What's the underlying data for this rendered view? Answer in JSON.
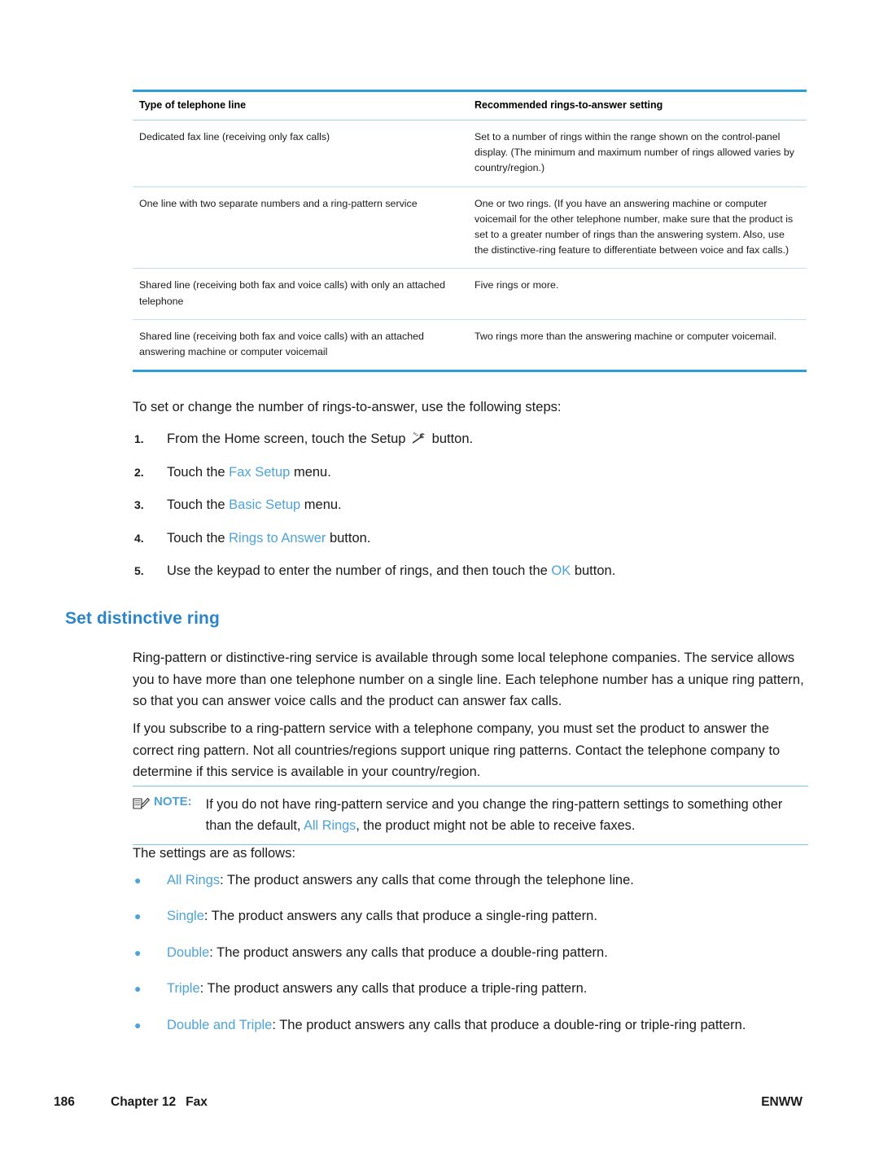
{
  "table": {
    "headers": [
      "Type of telephone line",
      "Recommended rings-to-answer setting"
    ],
    "rows": [
      {
        "type": "Dedicated fax line (receiving only fax calls)",
        "setting": "Set to a number of rings within the range shown on the control-panel display. (The minimum and maximum number of rings allowed varies by country/region.)"
      },
      {
        "type": "One line with two separate numbers and a ring-pattern service",
        "setting": "One or two rings. (If you have an answering machine or computer voicemail for the other telephone number, make sure that the product is set to a greater number of rings than the answering system. Also, use the distinctive-ring feature to differentiate between voice and fax calls.)"
      },
      {
        "type": "Shared line (receiving both fax and voice calls) with only an attached telephone",
        "setting": "Five rings or more."
      },
      {
        "type": "Shared line (receiving both fax and voice calls) with an attached answering machine or computer voicemail",
        "setting": "Two rings more than the answering machine or computer voicemail."
      }
    ]
  },
  "intro": "To set or change the number of rings-to-answer, use the following steps:",
  "steps": [
    {
      "num": "1.",
      "pre": "From the Home screen, touch the Setup ",
      "ui": "",
      "post": " button.",
      "icon": "setup-wrench-icon"
    },
    {
      "num": "2.",
      "pre": "Touch the ",
      "ui": "Fax Setup",
      "post": " menu."
    },
    {
      "num": "3.",
      "pre": "Touch the ",
      "ui": "Basic Setup",
      "post": " menu."
    },
    {
      "num": "4.",
      "pre": "Touch the ",
      "ui": "Rings to Answer",
      "post": " button."
    },
    {
      "num": "5.",
      "pre": "Use the keypad to enter the number of rings, and then touch the ",
      "ui": "OK",
      "post": " button."
    }
  ],
  "heading": "Set distinctive ring",
  "paragraphs": {
    "p1": "Ring-pattern or distinctive-ring service is available through some local telephone companies. The service allows you to have more than one telephone number on a single line. Each telephone number has a unique ring pattern, so that you can answer voice calls and the product can answer fax calls.",
    "p2": "If you subscribe to a ring-pattern service with a telephone company, you must set the product to answer the correct ring pattern. Not all countries/regions support unique ring patterns. Contact the telephone company to determine if this service is available in your country/region.",
    "p3": "The settings are as follows:"
  },
  "note": {
    "label": "NOTE:",
    "pre": "If you do not have ring-pattern service and you change the ring-pattern settings to something other than the default, ",
    "ui": "All Rings",
    "post": ", the product might not be able to receive faxes.",
    "icon": "note-pencil-icon"
  },
  "bullets": [
    {
      "marker": "●",
      "ui": "All Rings",
      "text": ": The product answers any calls that come through the telephone line."
    },
    {
      "marker": "●",
      "ui": "Single",
      "text": ": The product answers any calls that produce a single-ring pattern."
    },
    {
      "marker": "●",
      "ui": "Double",
      "text": ": The product answers any calls that produce a double-ring pattern."
    },
    {
      "marker": "●",
      "ui": "Triple",
      "text": ": The product answers any calls that produce a triple-ring pattern."
    },
    {
      "marker": "●",
      "ui": "Double and Triple",
      "text": ": The product answers any calls that produce a double-ring or triple-ring pattern."
    }
  ],
  "footer": {
    "page_number": "186",
    "chapter": "Chapter 12",
    "chapter_title": "Fax",
    "right": "ENWW"
  },
  "colors": {
    "accent_blue": "#2a86c8",
    "ui_blue": "#4da3d8",
    "rule_blue": "#2a9fd6"
  }
}
